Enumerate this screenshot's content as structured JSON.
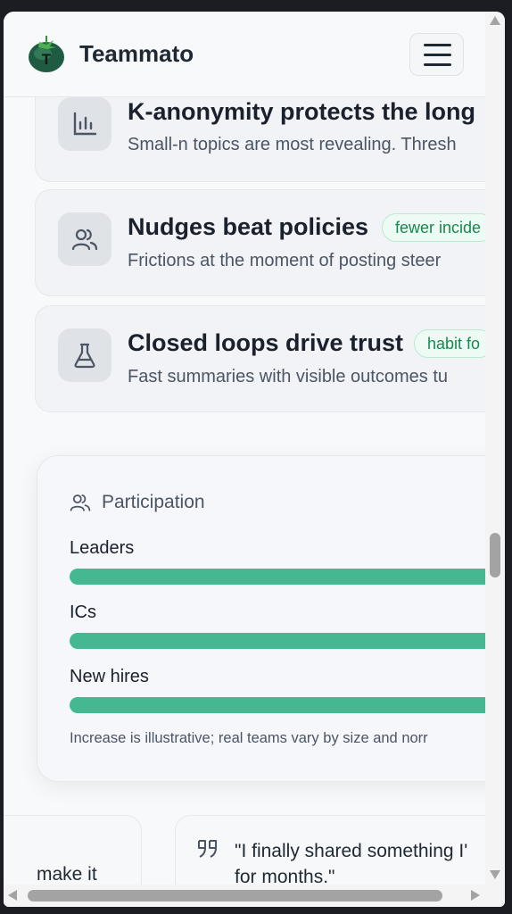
{
  "app": {
    "name": "Teammato"
  },
  "header": {
    "menu_label": "Open menu"
  },
  "insights": [
    {
      "title": "K-anonymity protects the long",
      "tag": "",
      "desc": "Small-n topics are most revealing. Thresh",
      "icon": "bar-chart-icon"
    },
    {
      "title": "Nudges beat policies",
      "tag": "fewer incide",
      "desc": "Frictions at the moment of posting steer",
      "icon": "users-icon"
    },
    {
      "title": "Closed loops drive trust",
      "tag": "habit fo",
      "desc": "Fast summaries with visible outcomes tu",
      "icon": "flask-icon"
    }
  ],
  "participation": {
    "title": "Participation",
    "bars": [
      {
        "label": "Leaders",
        "value": 1.0
      },
      {
        "label": "ICs",
        "value": 1.0
      },
      {
        "label": "New hires",
        "value": 1.0
      }
    ],
    "note": "Increase is illustrative; real teams vary by size and norr"
  },
  "testimonials": {
    "left_fragment": "make it",
    "right_quote": "\"I finally shared something I'\nfor months.\""
  },
  "colors": {
    "accent": "#45b891",
    "tag_text": "#17884f"
  }
}
